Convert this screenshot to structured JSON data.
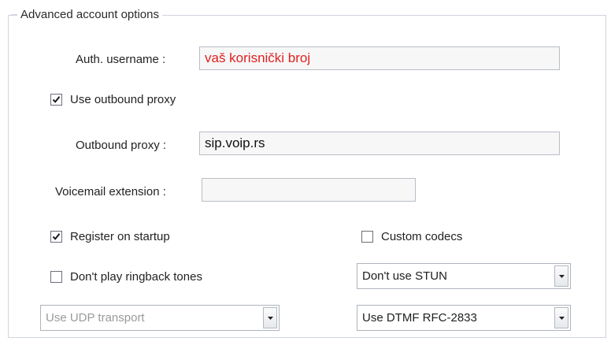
{
  "group": {
    "title": "Advanced account options"
  },
  "fields": {
    "auth_username_label": "Auth. username :",
    "auth_username_value": "vaš korisnički broj",
    "use_outbound_proxy_label": "Use outbound proxy",
    "use_outbound_proxy_checked": true,
    "outbound_proxy_label": "Outbound proxy :",
    "outbound_proxy_value": "sip.voip.rs",
    "voicemail_extension_label": "Voicemail extension :",
    "voicemail_extension_value": "",
    "register_on_startup_label": "Register on startup",
    "register_on_startup_checked": true,
    "custom_codecs_label": "Custom codecs",
    "custom_codecs_checked": false,
    "dont_play_ringback_label": "Don't play ringback tones",
    "dont_play_ringback_checked": false
  },
  "dropdowns": {
    "stun": "Don't use STUN",
    "transport": "Use UDP transport",
    "dtmf": "Use DTMF RFC-2833"
  },
  "icons": {
    "checkmark": "checkmark-icon",
    "dropdown_arrow": "chevron-down-icon"
  },
  "colors": {
    "username_text": "#e02020",
    "frame_border": "#cfd5dd"
  }
}
